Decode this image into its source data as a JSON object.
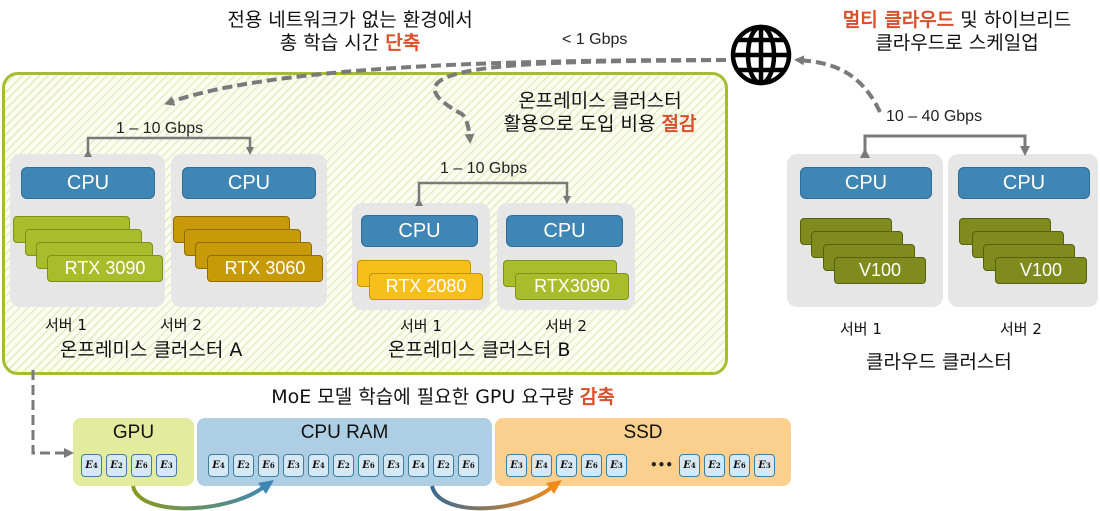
{
  "annotations": {
    "network_time": {
      "line1": "전용 네트워크가 없는 환경에서",
      "line2_prefix": "총 학습 시간 ",
      "line2_highlight": "단축"
    },
    "multicloud": {
      "line1_highlight": "멀티 클라우드",
      "line1_suffix": " 및 하이브리드",
      "line2": "클라우드로 스케일업"
    },
    "onprem_cost": {
      "line1": "온프레미스 클러스터",
      "line2_prefix": "활용으로 도입 비용 ",
      "line2_highlight": "절감"
    },
    "moe": {
      "prefix": "MoE 모델 학습에 필요한 GPU 요구량 ",
      "highlight": "감축"
    }
  },
  "colors": {
    "highlight": "#d9502a",
    "onprem_border": "#a5bd30",
    "cpu": "#3f86b4"
  },
  "links": {
    "internet": "< 1 Gbps",
    "cluster_a": "1 – 10 Gbps",
    "cluster_b": "1 – 10 Gbps",
    "cloud": "10 – 40 Gbps"
  },
  "globe_icon": "globe-icon",
  "clusters": [
    {
      "name": "온프레미스 클러스터 A",
      "servers": [
        {
          "label": "서버 1",
          "cpu": "CPU",
          "gpu": "RTX 3090",
          "gpu_count": 4,
          "gpu_color": "#a9bd2c"
        },
        {
          "label": "서버 2",
          "cpu": "CPU",
          "gpu": "RTX 3060",
          "gpu_count": 4,
          "gpu_color": "#c79a0a"
        }
      ]
    },
    {
      "name": "온프레미스 클러스터 B",
      "servers": [
        {
          "label": "서버 1",
          "cpu": "CPU",
          "gpu": "RTX 2080",
          "gpu_count": 2,
          "gpu_color": "#f6bf1c"
        },
        {
          "label": "서버 2",
          "cpu": "CPU",
          "gpu": "RTX3090",
          "gpu_count": 2,
          "gpu_color": "#a9bd2c"
        }
      ]
    },
    {
      "name": "클라우드 클러스터",
      "servers": [
        {
          "label": "서버 1",
          "cpu": "CPU",
          "gpu": "V100",
          "gpu_count": 4,
          "gpu_color": "#7f8c1d"
        },
        {
          "label": "서버 2",
          "cpu": "CPU",
          "gpu": "V100",
          "gpu_count": 4,
          "gpu_color": "#7f8c1d"
        }
      ]
    }
  ],
  "memory": {
    "gpu": {
      "title": "GPU",
      "experts": [
        "4",
        "2",
        "6",
        "3"
      ]
    },
    "cpu_ram": {
      "title": "CPU RAM",
      "experts": [
        "4",
        "2",
        "6",
        "3",
        "4",
        "2",
        "6",
        "3",
        "4",
        "2",
        "6"
      ]
    },
    "ssd": {
      "title": "SSD",
      "experts_left": [
        "3",
        "4",
        "2",
        "6",
        "3"
      ],
      "ellipsis": "•••",
      "experts_right": [
        "4",
        "2",
        "6",
        "3"
      ]
    }
  }
}
